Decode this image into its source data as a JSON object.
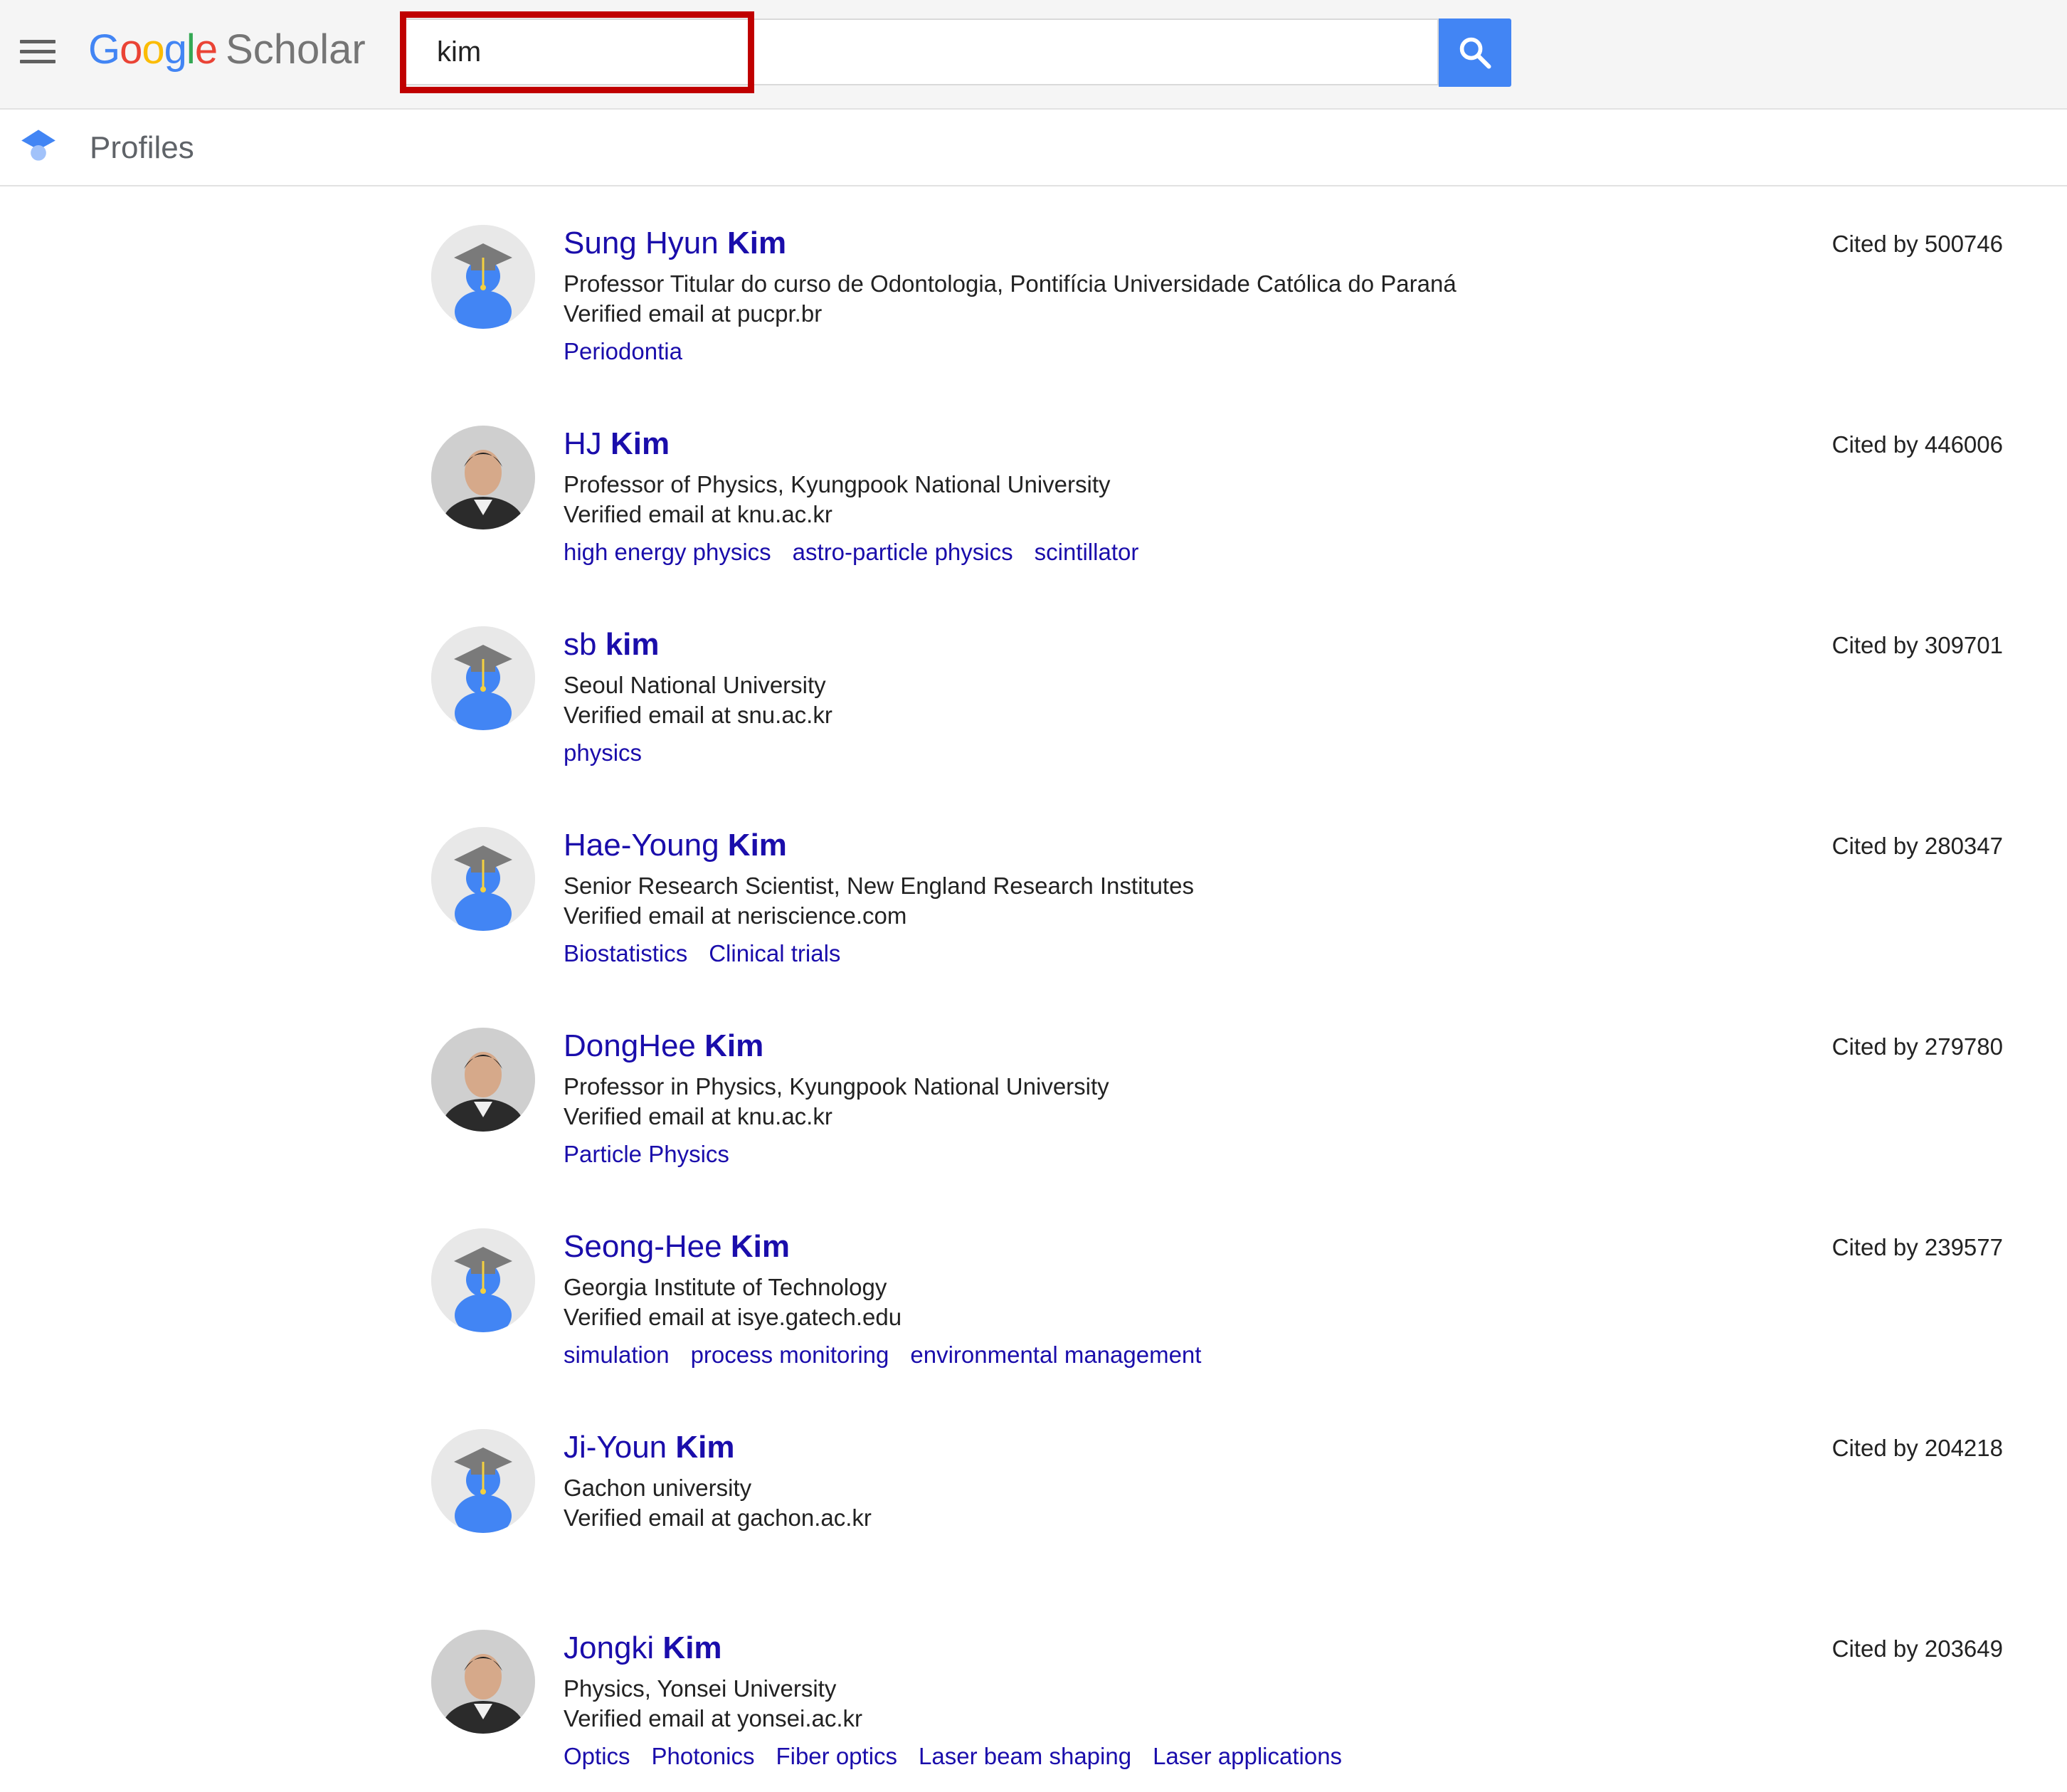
{
  "header": {
    "logo": {
      "G": "G",
      "o1": "o",
      "o2": "o",
      "g": "g",
      "l": "l",
      "e": "e",
      "scholar": "Scholar"
    },
    "search": {
      "value": "kim",
      "placeholder": ""
    }
  },
  "subheader": {
    "title": "Profiles"
  },
  "colors": {
    "link": "#1a0dab",
    "search_button": "#4285f4",
    "highlight_box": "#c00000",
    "google_blue": "#4285f4",
    "google_red": "#ea4335",
    "google_yellow": "#fbbc05",
    "google_green": "#34a853"
  },
  "results": [
    {
      "name_first": "Sung Hyun ",
      "name_last": "Kim",
      "affiliation": "Professor Titular do curso de Odontologia, Pontifícia Universidade Católica do Paraná",
      "email": "Verified email at pucpr.br",
      "interests": [
        "Periodontia"
      ],
      "cited": "Cited by 500746",
      "avatar": "default-scholar-avatar"
    },
    {
      "name_first": "HJ ",
      "name_last": "Kim",
      "affiliation": "Professor of Physics, Kyungpook National University",
      "email": "Verified email at knu.ac.kr",
      "interests": [
        "high energy physics",
        "astro-particle physics",
        "scintillator"
      ],
      "cited": "Cited by 446006",
      "avatar": "profile-photo"
    },
    {
      "name_first": "sb ",
      "name_last": "kim",
      "affiliation": "Seoul National University",
      "email": "Verified email at snu.ac.kr",
      "interests": [
        "physics"
      ],
      "cited": "Cited by 309701",
      "avatar": "default-scholar-avatar"
    },
    {
      "name_first": "Hae-Young ",
      "name_last": "Kim",
      "affiliation": "Senior Research Scientist, New England Research Institutes",
      "email": "Verified email at neriscience.com",
      "interests": [
        "Biostatistics",
        "Clinical trials"
      ],
      "cited": "Cited by 280347",
      "avatar": "default-scholar-avatar"
    },
    {
      "name_first": "DongHee ",
      "name_last": "Kim",
      "affiliation": "Professor in Physics, Kyungpook National University",
      "email": "Verified email at knu.ac.kr",
      "interests": [
        "Particle Physics"
      ],
      "cited": "Cited by 279780",
      "avatar": "profile-photo"
    },
    {
      "name_first": "Seong-Hee ",
      "name_last": "Kim",
      "affiliation": "Georgia Institute of Technology",
      "email": "Verified email at isye.gatech.edu",
      "interests": [
        "simulation",
        "process monitoring",
        "environmental management"
      ],
      "cited": "Cited by 239577",
      "avatar": "default-scholar-avatar"
    },
    {
      "name_first": "Ji-Youn ",
      "name_last": "Kim",
      "affiliation": "Gachon university",
      "email": "Verified email at gachon.ac.kr",
      "interests": [],
      "cited": "Cited by 204218",
      "avatar": "default-scholar-avatar"
    },
    {
      "name_first": "Jongki ",
      "name_last": "Kim",
      "affiliation": "Physics, Yonsei University",
      "email": "Verified email at yonsei.ac.kr",
      "interests": [
        "Optics",
        "Photonics",
        "Fiber optics",
        "Laser beam shaping",
        "Laser applications"
      ],
      "cited": "Cited by 203649",
      "avatar": "profile-photo"
    }
  ]
}
